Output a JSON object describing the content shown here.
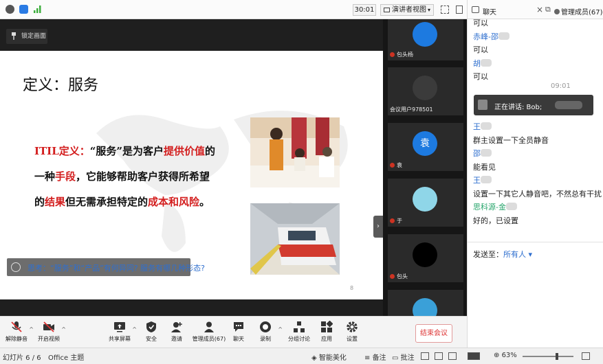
{
  "topbar": {
    "timer": "30:01",
    "view_mode": "演讲者视图"
  },
  "stage": {
    "lock_label": "锁定画面",
    "slide": {
      "title": "定义：服务",
      "body_parts": [
        {
          "t": "ITIL定义：",
          "red": true
        },
        {
          "t": "“服务”是为客户",
          "red": false
        },
        {
          "t": "提供价值",
          "red": true
        },
        {
          "t": "的一种",
          "red": false
        },
        {
          "t": "手段",
          "red": true
        },
        {
          "t": "，它能够帮助客户获得所希望的",
          "red": false
        },
        {
          "t": "结果",
          "red": true
        },
        {
          "t": "但无需承担特定的",
          "red": false
        },
        {
          "t": "成本和风险",
          "red": true
        },
        {
          "t": "。",
          "red": false
        }
      ],
      "question": "思考：“服务”和“产品”有何异同? 服务有哪几种形态?",
      "page": "8"
    }
  },
  "participants": [
    {
      "label": "包头杨",
      "avatar_color": "#1d7ae0"
    },
    {
      "label": "会议用户978501",
      "avatar_color": "#3b3b3b"
    },
    {
      "label": "袁",
      "avatar_color": "#1d7ae0",
      "avatar_text": "袁"
    },
    {
      "label": "于",
      "avatar_color": "#8fd6e8"
    },
    {
      "label": "包头",
      "avatar_color": "#000000"
    },
    {
      "label": "",
      "avatar_color": "#3aa0d8"
    }
  ],
  "chat": {
    "tab_chat": "聊天",
    "tab_members": "管理成员(67)",
    "messages": [
      {
        "kind": "text",
        "text": "可以"
      },
      {
        "kind": "name",
        "text": "赤峰-邵",
        "color": "blue"
      },
      {
        "kind": "text",
        "text": "可以"
      },
      {
        "kind": "name",
        "text": "胡",
        "color": "blue"
      },
      {
        "kind": "text",
        "text": "可以"
      }
    ],
    "timestamp": "09:01",
    "speaking": "正在讲话: Bob;",
    "messages2": [
      {
        "kind": "name",
        "text": "王",
        "color": "blue"
      },
      {
        "kind": "text",
        "text": "群主设置一下全员静音"
      },
      {
        "kind": "name",
        "text": "邵",
        "color": "blue"
      },
      {
        "kind": "text",
        "text": "能看见"
      },
      {
        "kind": "name",
        "text": "王",
        "color": "blue"
      },
      {
        "kind": "text",
        "text": "设置一下其它人静音吧，不然总有干扰"
      },
      {
        "kind": "name",
        "text": "思科源-金",
        "color": "green"
      },
      {
        "kind": "text",
        "text": "好的，已设置"
      }
    ],
    "send_to_label": "发送至：",
    "send_to_value": "所有人 ▾"
  },
  "controls": {
    "unmute": "解除静音",
    "video": "开启视频",
    "share": "共享屏幕",
    "security": "安全",
    "invite": "邀请",
    "members": "管理成员(67)",
    "chat": "聊天",
    "record": "录制",
    "breakout": "分组讨论",
    "apps": "应用",
    "settings": "设置",
    "end": "结束会议"
  },
  "statusbar": {
    "slide_count": "幻灯片 6 / 6",
    "theme": "Office 主题",
    "beautify": "智能美化",
    "notes": "备注",
    "comments": "批注",
    "zoom": "63%"
  },
  "colors": {
    "accent_blue": "#2f6fcf",
    "red": "#d31d1d",
    "green": "#26a56b"
  }
}
